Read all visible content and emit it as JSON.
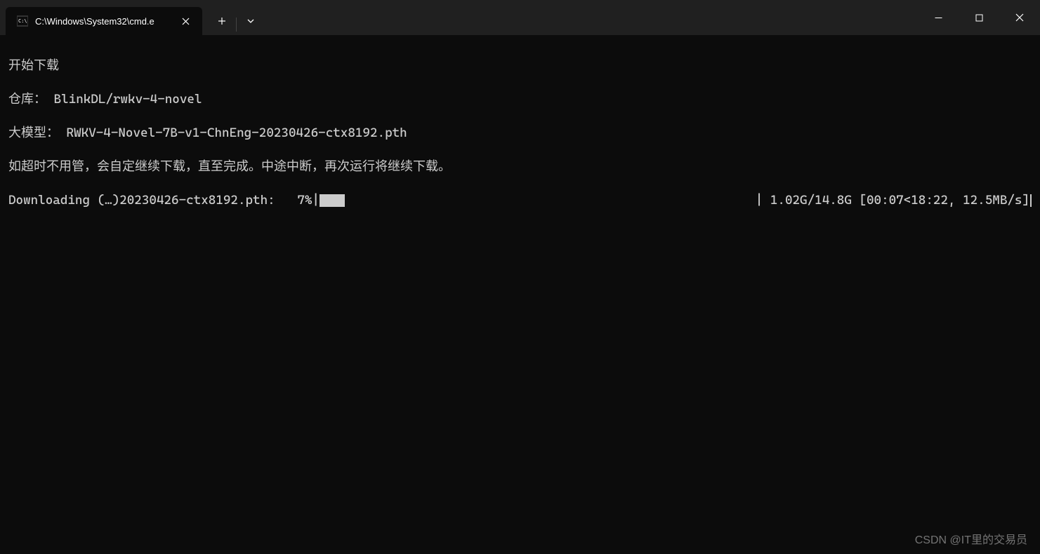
{
  "titlebar": {
    "tab_title": "C:\\Windows\\System32\\cmd.e"
  },
  "terminal": {
    "line1": "开始下载",
    "line2_label": "仓库：",
    "line2_value": "BlinkDL/rwkv-4-novel",
    "line3_label": "大模型：",
    "line3_value": "RWKV-4-Novel-7B-v1-ChnEng-20230426-ctx8192.pth",
    "line4": "如超时不用管，会自定继续下载，直至完成。中途中断，再次运行将继续下载。",
    "progress": {
      "prefix": "Downloading (…)20230426-ctx8192.pth:   ",
      "percent": "7%",
      "bar_sep_left": "|",
      "bar_sep_right": "| ",
      "stats": "1.02G/14.8G [00:07<18:22, 12.5MB/s]"
    }
  },
  "watermark": "CSDN @IT里的交易员"
}
